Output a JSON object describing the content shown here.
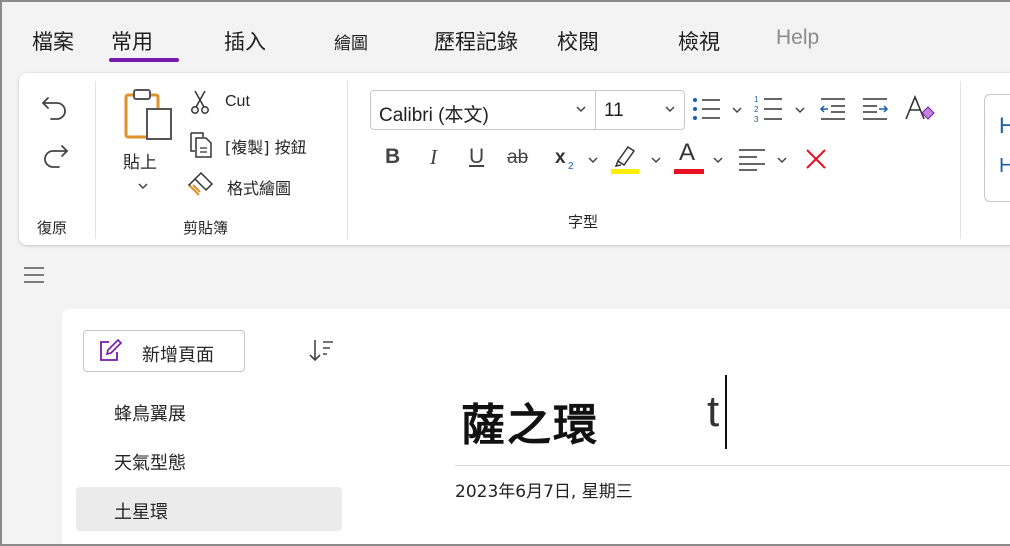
{
  "menu": {
    "tabs": [
      {
        "label": "檔案"
      },
      {
        "label": "常用",
        "selected": true
      },
      {
        "label": "插入"
      },
      {
        "label": "繪圖"
      },
      {
        "label": "歷程記錄"
      },
      {
        "label": "校閱"
      },
      {
        "label": "檢視"
      },
      {
        "label": "Help"
      }
    ]
  },
  "ribbon": {
    "undo_group": {
      "label": "復原",
      "undo_icon": "undo-icon",
      "redo_icon": "redo-icon"
    },
    "clipboard": {
      "label": "剪貼簿",
      "paste_label": "貼上",
      "cut_label": "Cut",
      "copy_label": "[複製] 按鈕",
      "format_painter_label": "格式繪圖"
    },
    "font": {
      "label": "字型",
      "font_name": "Calibri (本文)",
      "font_size": "11",
      "bold": "B",
      "italic": "I",
      "underline": "U",
      "strikethrough": "ab",
      "subscript": "x",
      "subscript_sub": "2",
      "font_color_letter": "A",
      "highlight_color": "#ffee00",
      "font_color": "#e81123"
    },
    "partial_style": {
      "line1": "H",
      "line2": "H"
    }
  },
  "accent_color": "#7719aa",
  "sidebar": {
    "new_page_label": "新增頁面",
    "pages": [
      {
        "label": "蜂鳥翼展"
      },
      {
        "label": "天氣型態"
      },
      {
        "label": "土星環",
        "selected": true
      }
    ]
  },
  "page": {
    "title": "薩之環",
    "body_text": "t",
    "date": "2023年6月7日, 星期三"
  }
}
